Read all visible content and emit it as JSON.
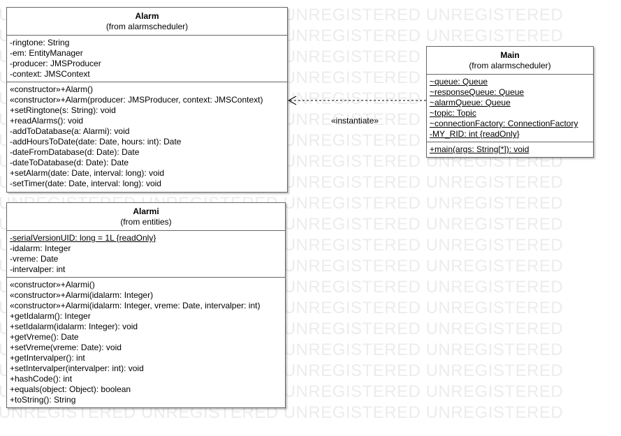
{
  "watermark": {
    "text": "UNREGISTERED UNREGISTERED UNREGISTERED UNREGISTERED"
  },
  "classes": {
    "alarm": {
      "name": "Alarm",
      "from": "(from alarmscheduler)",
      "attributes": [
        "-ringtone: String",
        "-em: EntityManager",
        "-producer: JMSProducer",
        "-context: JMSContext"
      ],
      "operations": [
        "«constructor»+Alarm()",
        "«constructor»+Alarm(producer: JMSProducer, context: JMSContext)",
        "+setRingtone(s: String): void",
        "+readAlarms(): void",
        "-addToDatabase(a: Alarmi): void",
        "-addHoursToDate(date: Date, hours: int): Date",
        "-dateFromDatabase(d: Date): Date",
        "-dateToDatabase(d: Date): Date",
        "+setAlarm(date: Date, interval: long): void",
        "-setTimer(date: Date, interval: long): void"
      ]
    },
    "alarmi": {
      "name": "Alarmi",
      "from": "(from entities)",
      "attributes": [
        "-serialVersionUID: long = 1L {readOnly}",
        "-idalarm: Integer",
        "-vreme: Date",
        "-intervalper: int"
      ],
      "operations": [
        "«constructor»+Alarmi()",
        "«constructor»+Alarmi(idalarm: Integer)",
        "«constructor»+Alarmi(idalarm: Integer, vreme: Date, intervalper: int)",
        "+getIdalarm(): Integer",
        "+setIdalarm(idalarm: Integer): void",
        "+getVreme(): Date",
        "+setVreme(vreme: Date): void",
        "+getIntervalper(): int",
        "+setIntervalper(intervalper: int): void",
        "+hashCode(): int",
        "+equals(object: Object): boolean",
        "+toString(): String"
      ]
    },
    "main": {
      "name": "Main",
      "from": "(from alarmscheduler)",
      "attributes": [
        "~queue: Queue",
        "~responseQueue: Queue",
        "~alarmQueue: Queue",
        "~topic: Topic",
        "~connectionFactory: ConnectionFactory",
        "-MY_RID: int {readOnly}"
      ],
      "operations": [
        "+main(args: String[*]): void"
      ]
    }
  },
  "dependency": {
    "label": "«instantiate»"
  }
}
